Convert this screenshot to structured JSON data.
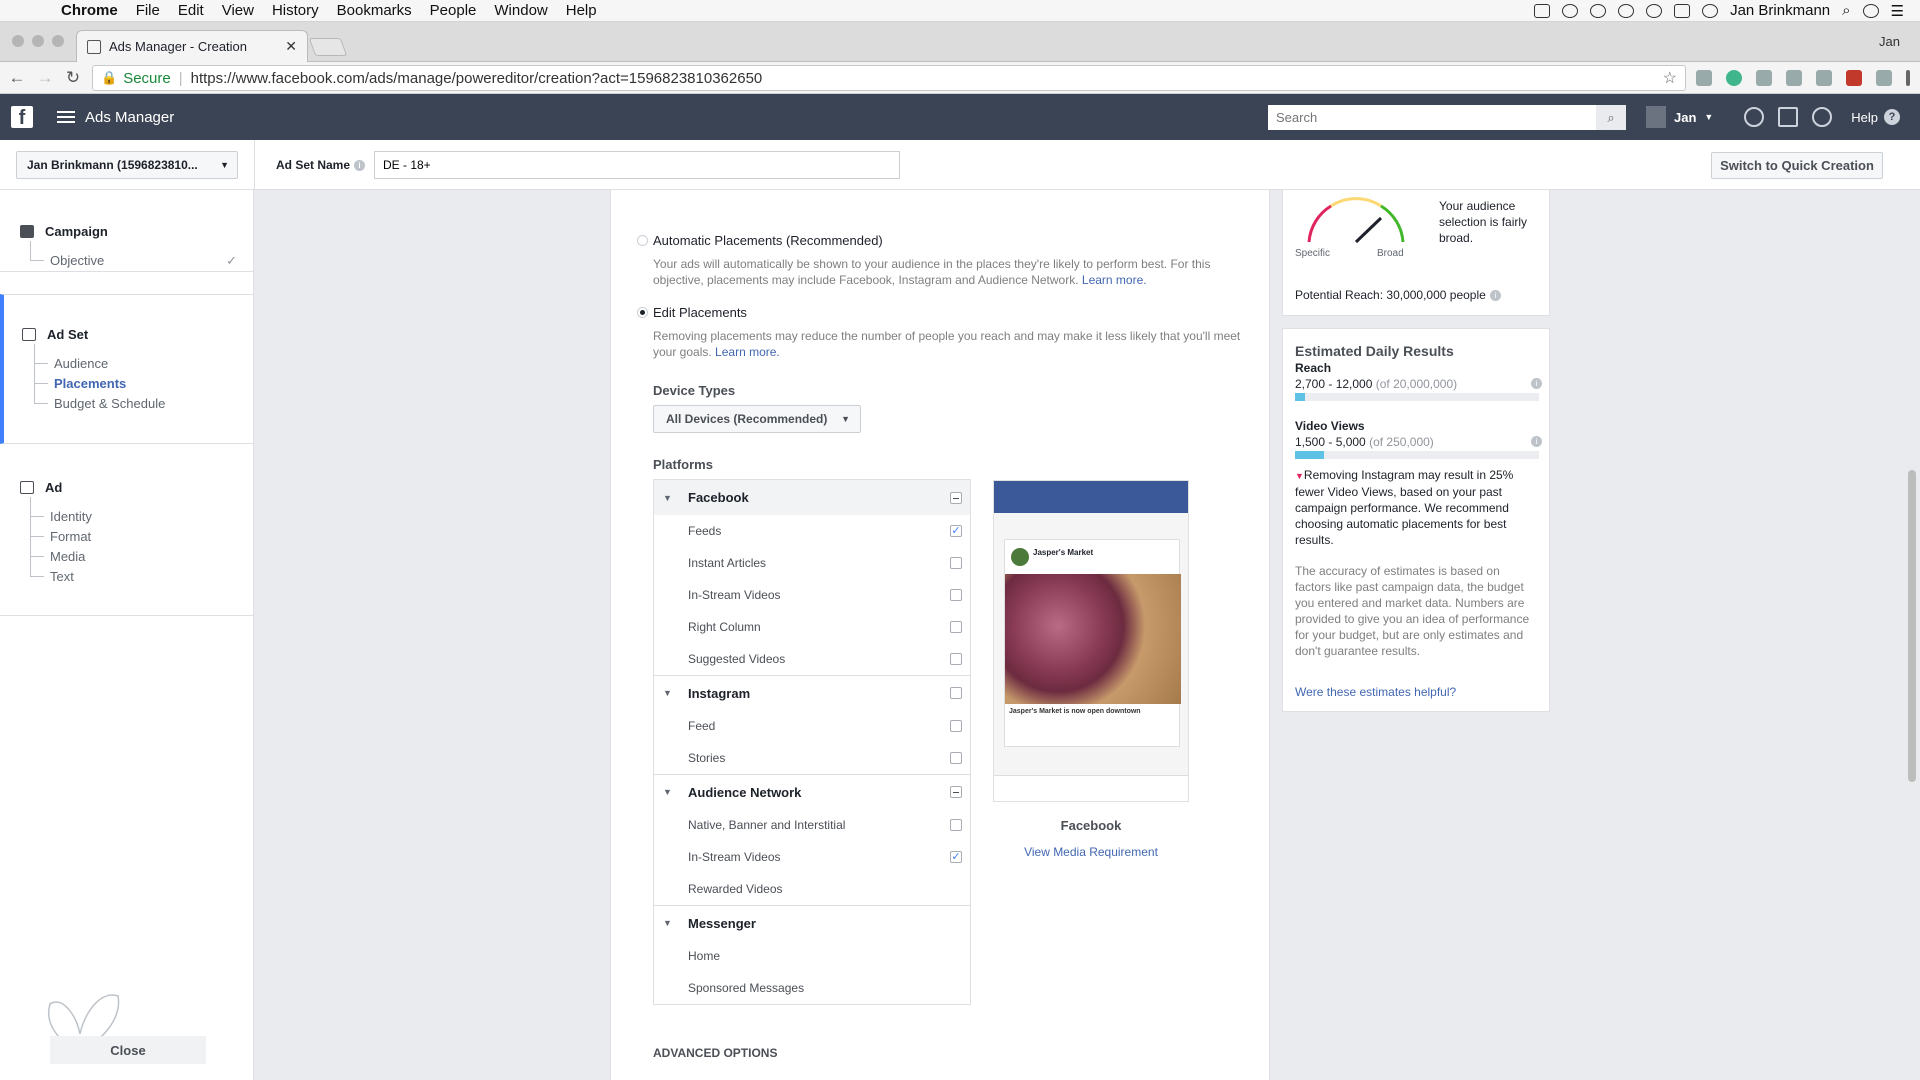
{
  "menubar": {
    "app": "Chrome",
    "items": [
      "File",
      "Edit",
      "View",
      "History",
      "Bookmarks",
      "People",
      "Window",
      "Help"
    ],
    "user": "Jan Brinkmann"
  },
  "browser": {
    "tab_title": "Ads Manager - Creation",
    "profile": "Jan",
    "secure_label": "Secure",
    "url": "https://www.facebook.com/ads/manage/powereditor/creation?act=1596823810362650"
  },
  "fbheader": {
    "title": "Ads Manager",
    "search_placeholder": "Search",
    "user": "Jan",
    "help": "Help"
  },
  "subheader": {
    "account": "Jan Brinkmann (1596823810...",
    "adset_name_label": "Ad Set Name",
    "adset_name_value": "DE - 18+",
    "quick_creation": "Switch to Quick Creation"
  },
  "leftnav": {
    "campaign": {
      "title": "Campaign",
      "items": [
        "Objective"
      ]
    },
    "adset": {
      "title": "Ad Set",
      "items": [
        "Audience",
        "Placements",
        "Budget & Schedule"
      ],
      "selected": "Placements"
    },
    "ad": {
      "title": "Ad",
      "items": [
        "Identity",
        "Format",
        "Media",
        "Text"
      ]
    },
    "close": "Close"
  },
  "placements": {
    "auto_title": "Automatic Placements (Recommended)",
    "auto_desc": "Your ads will automatically be shown to your audience in the places they're likely to perform best. For this objective, placements may include Facebook, Instagram and Audience Network.",
    "edit_title": "Edit Placements",
    "edit_desc": "Removing placements may reduce the number of people you reach and may make it less likely that you'll meet your goals.",
    "learn_more": "Learn more.",
    "device_types_label": "Device Types",
    "device_types_value": "All Devices (Recommended)",
    "platforms_label": "Platforms",
    "groups": [
      {
        "name": "Facebook",
        "state": "partial",
        "items": [
          {
            "label": "Feeds",
            "checked": true
          },
          {
            "label": "Instant Articles",
            "checked": false
          },
          {
            "label": "In-Stream Videos",
            "checked": false
          },
          {
            "label": "Right Column",
            "checked": false
          },
          {
            "label": "Suggested Videos",
            "checked": false
          }
        ]
      },
      {
        "name": "Instagram",
        "state": "unchecked",
        "items": [
          {
            "label": "Feed",
            "checked": false
          },
          {
            "label": "Stories",
            "checked": false
          }
        ]
      },
      {
        "name": "Audience Network",
        "state": "partial",
        "items": [
          {
            "label": "Native, Banner and Interstitial",
            "checked": false
          },
          {
            "label": "In-Stream Videos",
            "checked": true
          },
          {
            "label": "Rewarded Videos",
            "checked": null
          }
        ]
      },
      {
        "name": "Messenger",
        "state": "none",
        "items": [
          {
            "label": "Home",
            "checked": null
          },
          {
            "label": "Sponsored Messages",
            "checked": null
          }
        ]
      }
    ],
    "preview_label": "Facebook",
    "preview_link": "View Media Requirement",
    "preview_post_name": "Jasper's Market",
    "preview_caption": "Jasper's Market is now open downtown",
    "advanced": "ADVANCED OPTIONS"
  },
  "audience": {
    "text": "Your audience selection is fairly broad.",
    "specific": "Specific",
    "broad": "Broad",
    "potential_reach": "Potential Reach: 30,000,000 people"
  },
  "estimates": {
    "title": "Estimated Daily Results",
    "reach_label": "Reach",
    "reach_value": "2,700 - 12,000",
    "reach_total": "(of 20,000,000)",
    "reach_fill": 0.04,
    "views_label": "Video Views",
    "views_value": "1,500 - 5,000",
    "views_total": "(of 250,000)",
    "views_fill": 0.12,
    "warning": "Removing Instagram may result in 25% fewer Video Views, based on your past campaign performance. We recommend choosing automatic placements for best results.",
    "accuracy": "The accuracy of estimates is based on factors like past campaign data, the budget you entered and market data. Numbers are provided to give you an idea of performance for your budget, but are only estimates and don't guarantee results.",
    "helpful": "Were these estimates helpful?"
  },
  "colors": {
    "fb_header": "#3b4454",
    "link": "#4267b2",
    "accent": "#4080ff",
    "bar": "#5fc2e4"
  }
}
